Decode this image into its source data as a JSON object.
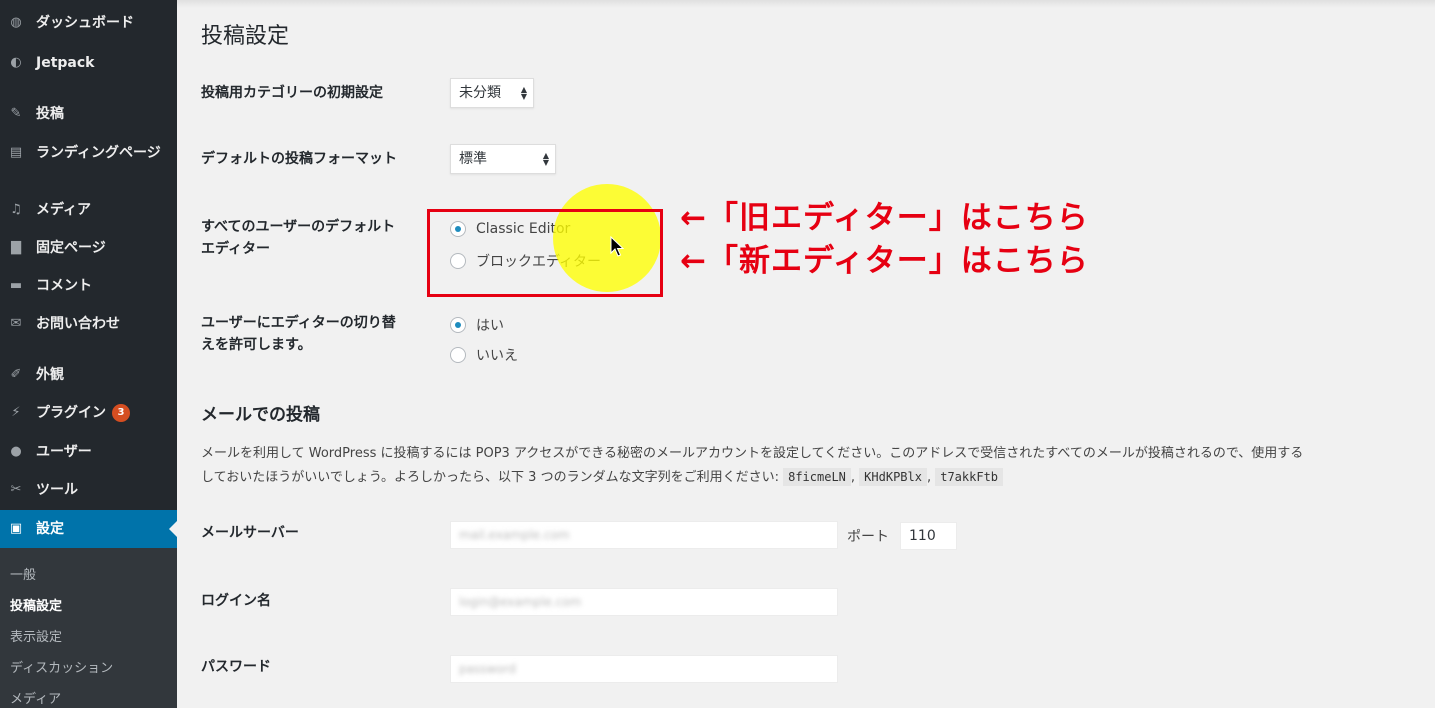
{
  "sidebar": {
    "items": [
      {
        "icon": "dashboard-icon",
        "label": "ダッシュボード"
      },
      {
        "icon": "jetpack-icon",
        "label": "Jetpack"
      },
      {
        "icon": "pin-icon",
        "label": "投稿"
      },
      {
        "icon": "landing-page-icon",
        "label": "ランディングページ"
      },
      {
        "icon": "media-icon",
        "label": "メディア"
      },
      {
        "icon": "page-icon",
        "label": "固定ページ"
      },
      {
        "icon": "comment-icon",
        "label": "コメント"
      },
      {
        "icon": "mail-icon",
        "label": "お問い合わせ"
      },
      {
        "icon": "appearance-icon",
        "label": "外観"
      },
      {
        "icon": "plugin-icon",
        "label": "プラグイン",
        "badge": "3"
      },
      {
        "icon": "user-icon",
        "label": "ユーザー"
      },
      {
        "icon": "wrench-icon",
        "label": "ツール"
      },
      {
        "icon": "settings-icon",
        "label": "設定"
      }
    ],
    "submenu": [
      "一般",
      "投稿設定",
      "表示設定",
      "ディスカッション",
      "メディア"
    ],
    "active_submenu": "投稿設定"
  },
  "page": {
    "title": "投稿設定",
    "category": {
      "label": "投稿用カテゴリーの初期設定",
      "value": "未分類"
    },
    "format": {
      "label": "デフォルトの投稿フォーマット",
      "value": "標準"
    },
    "editor": {
      "label_line1": "すべてのユーザーのデフォルト",
      "label_line2": "エディター",
      "options": [
        "Classic Editor",
        "ブロックエディター"
      ],
      "selected": "Classic Editor"
    },
    "allow_switch": {
      "label_line1": "ユーザーにエディターの切り替",
      "label_line2": "えを許可します。",
      "options": [
        "はい",
        "いいえ"
      ],
      "selected": "はい"
    },
    "mail": {
      "heading": "メールでの投稿",
      "desc_line1": "メールを利用して WordPress に投稿するには POP3 アクセスができる秘密のメールアカウントを設定してください。このアドレスで受信されたすべてのメールが投稿されるので、使用する",
      "desc_line2": "しておいたほうがいいでしょう。よろしかったら、以下 3 つのランダムな文字列をご利用ください:",
      "random_strings": [
        "8ficmeLN",
        "KHdKPBlx",
        "t7akkFtb"
      ],
      "server_label": "メールサーバー",
      "server_value": "mail.example.com",
      "port_label": "ポート",
      "port_value": "110",
      "login_label": "ログイン名",
      "login_value": "login@example.com",
      "password_label": "パスワード",
      "password_value": "password"
    }
  },
  "annotations": {
    "old_editor": "←「旧エディター」はこちら",
    "new_editor": "←「新エディター」はこちら"
  }
}
